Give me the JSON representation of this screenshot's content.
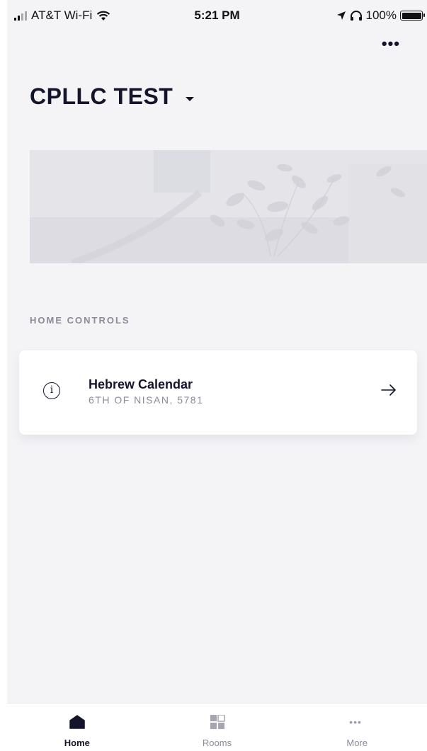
{
  "status_bar": {
    "carrier": "AT&T Wi-Fi",
    "time": "5:21 PM",
    "battery": "100%"
  },
  "header": {
    "more_icon": "ellipsis-icon",
    "title": "CPLLC TEST",
    "title_dropdown_icon": "caret-down-icon"
  },
  "section": {
    "label": "HOME CONTROLS"
  },
  "controls": [
    {
      "icon": "info-icon",
      "title": "Hebrew Calendar",
      "subtitle": "6TH OF NISAN, 5781",
      "action_icon": "arrow-right-icon"
    }
  ],
  "tab_bar": {
    "tabs": [
      {
        "label": "Home",
        "icon": "home-icon",
        "active": true
      },
      {
        "label": "Rooms",
        "icon": "grid-icon",
        "active": false
      },
      {
        "label": "More",
        "icon": "ellipsis-icon",
        "active": false
      }
    ]
  },
  "colors": {
    "background": "#f4f4f7",
    "primary_text": "#14152a",
    "secondary_text": "#8a8a99",
    "card": "#ffffff"
  }
}
